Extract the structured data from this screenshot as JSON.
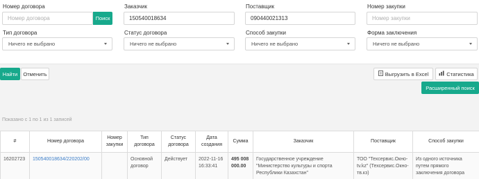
{
  "filters": {
    "contract_number": {
      "label": "Номер договора",
      "placeholder": "Номер договора",
      "search_button": "Поиск"
    },
    "customer": {
      "label": "Заказчик",
      "value": "150540018634"
    },
    "supplier": {
      "label": "Поставщик",
      "value": "090440021313"
    },
    "procurement_number": {
      "label": "Номер закупки",
      "placeholder": "Номер закупки"
    },
    "contract_type": {
      "label": "Тип договора",
      "value": "Ничего не выбрано"
    },
    "contract_status": {
      "label": "Статус договора",
      "value": "Ничего не выбрано"
    },
    "procurement_method": {
      "label": "Способ закупки",
      "value": "Ничего не выбрано"
    },
    "conclusion_form": {
      "label": "Форма заключения",
      "value": "Ничего не выбрано"
    }
  },
  "actions": {
    "find": "Найти",
    "cancel": "Отменить",
    "export_excel": "Выгрузить в Excel",
    "statistics": "Статистика",
    "advanced_search": "Расширенный поиск"
  },
  "results_info": "Показано с 1 по 1 из 1 записей",
  "table": {
    "headers": [
      "#",
      "Номер договора",
      "Номер закупки",
      "Тип договора",
      "Статус договора",
      "Дата создания",
      "Сумма",
      "Заказчик",
      "Поставщик",
      "Способ закупки"
    ],
    "rows": [
      [
        "16202723",
        "150540018634/220202/00",
        "",
        "Основной договор",
        "Действует",
        "2022-11-16 16:33:41",
        "495 008 000.00",
        "Государственное учреждение \"Министерство культуры и спорта Республики Казахстан\"",
        "ТОО \"Техсервис.Окно-tv.kz\" (Техсервис.Окно-тв.кз)",
        "Из одного источника путем прямого заключения договора"
      ]
    ]
  },
  "colors": {
    "accent": "#17a98c",
    "link": "#3a7cc7",
    "band": "#f3f3f3"
  },
  "icons": {
    "export": "file-excel-icon",
    "statistics": "chart-icon",
    "dropdown": "caret-down-icon"
  }
}
